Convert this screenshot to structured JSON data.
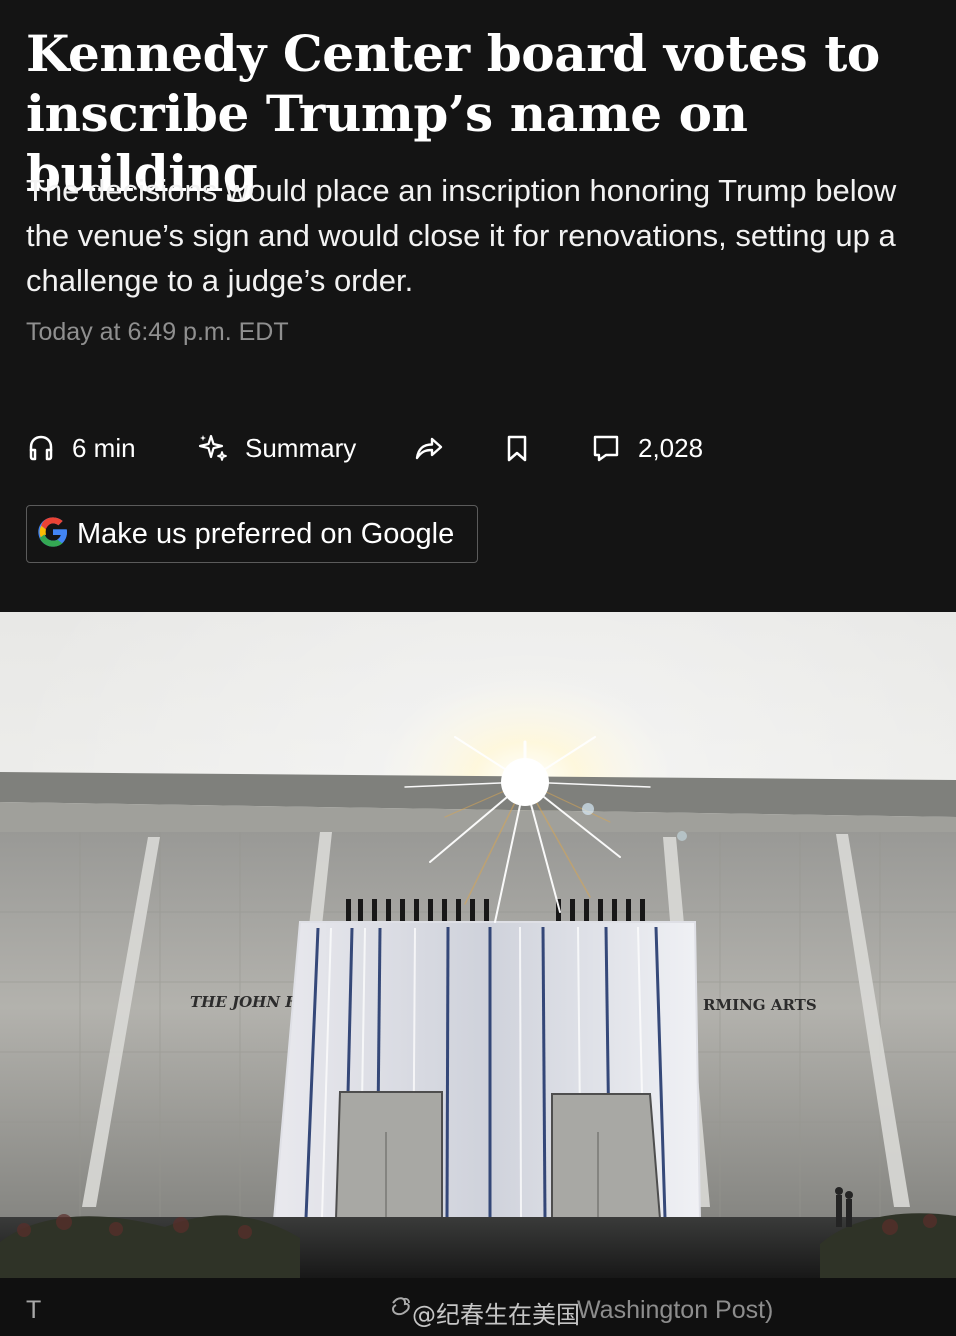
{
  "article": {
    "headline": "Kennedy Center board votes to inscribe Trump’s name on building",
    "dek": "The decisions would place an inscription honoring Trump below the venue’s sign and would close it for renovations, setting up a challenge to a judge’s order.",
    "timestamp": "Today at 6:49 p.m. EDT"
  },
  "toolbar": {
    "listen_label": "6 min",
    "summary_label": "Summary",
    "comment_count": "2,028",
    "icons": {
      "listen": "headphones-icon",
      "summary": "sparkle-icon",
      "share": "share-arrow-icon",
      "bookmark": "bookmark-icon",
      "comments": "comment-icon"
    }
  },
  "google_prompt": {
    "label": "Make us preferred on Google",
    "icon": "google-logo-icon"
  },
  "hero_image": {
    "sign_left": "THE JOHN F",
    "sign_right": "RMING ARTS"
  },
  "caption": {
    "prefix": "T",
    "watermark": "@纪春生在美国",
    "credit": "Washington Post)"
  },
  "colors": {
    "background": "#141414",
    "text": "#ffffff",
    "muted_text": "#8f8f8f",
    "button_border": "#5b5b5b"
  }
}
